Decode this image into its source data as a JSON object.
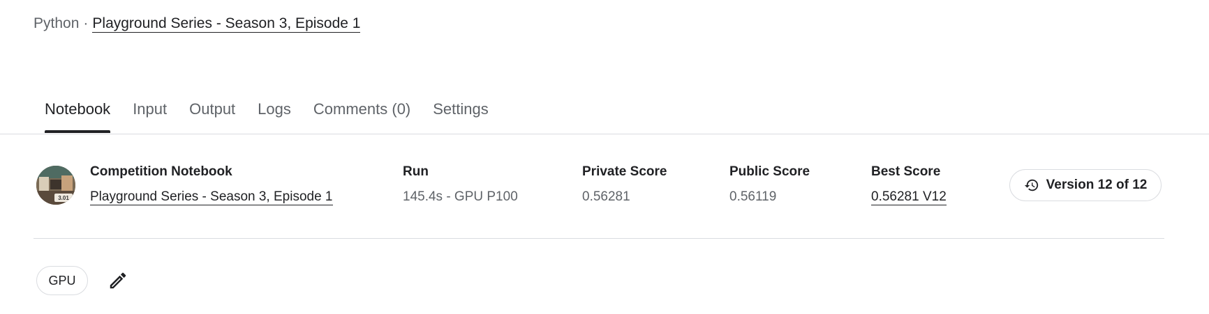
{
  "header": {
    "language": "Python",
    "separator": "·",
    "competition_link": "Playground Series - Season 3, Episode 1"
  },
  "tabs": [
    {
      "label": "Notebook",
      "active": true
    },
    {
      "label": "Input"
    },
    {
      "label": "Output"
    },
    {
      "label": "Logs"
    },
    {
      "label": "Comments (0)"
    },
    {
      "label": "Settings"
    }
  ],
  "info": {
    "thumbnail_badge": "3.01",
    "competition": {
      "label": "Competition Notebook",
      "value": "Playground Series - Season 3, Episode 1"
    },
    "run": {
      "label": "Run",
      "value": "145.4s - GPU P100"
    },
    "private_score": {
      "label": "Private Score",
      "value": "0.56281"
    },
    "public_score": {
      "label": "Public Score",
      "value": "0.56119"
    },
    "best_score": {
      "label": "Best Score",
      "value": "0.56281 V12"
    },
    "version_button": {
      "label": "Version 12 of 12",
      "icon": "history-icon"
    }
  },
  "tags": {
    "accelerator": "GPU",
    "edit_icon": "pencil-icon"
  },
  "colors": {
    "text_primary": "#202124",
    "text_secondary": "#5f6368",
    "border": "#dadce0"
  }
}
